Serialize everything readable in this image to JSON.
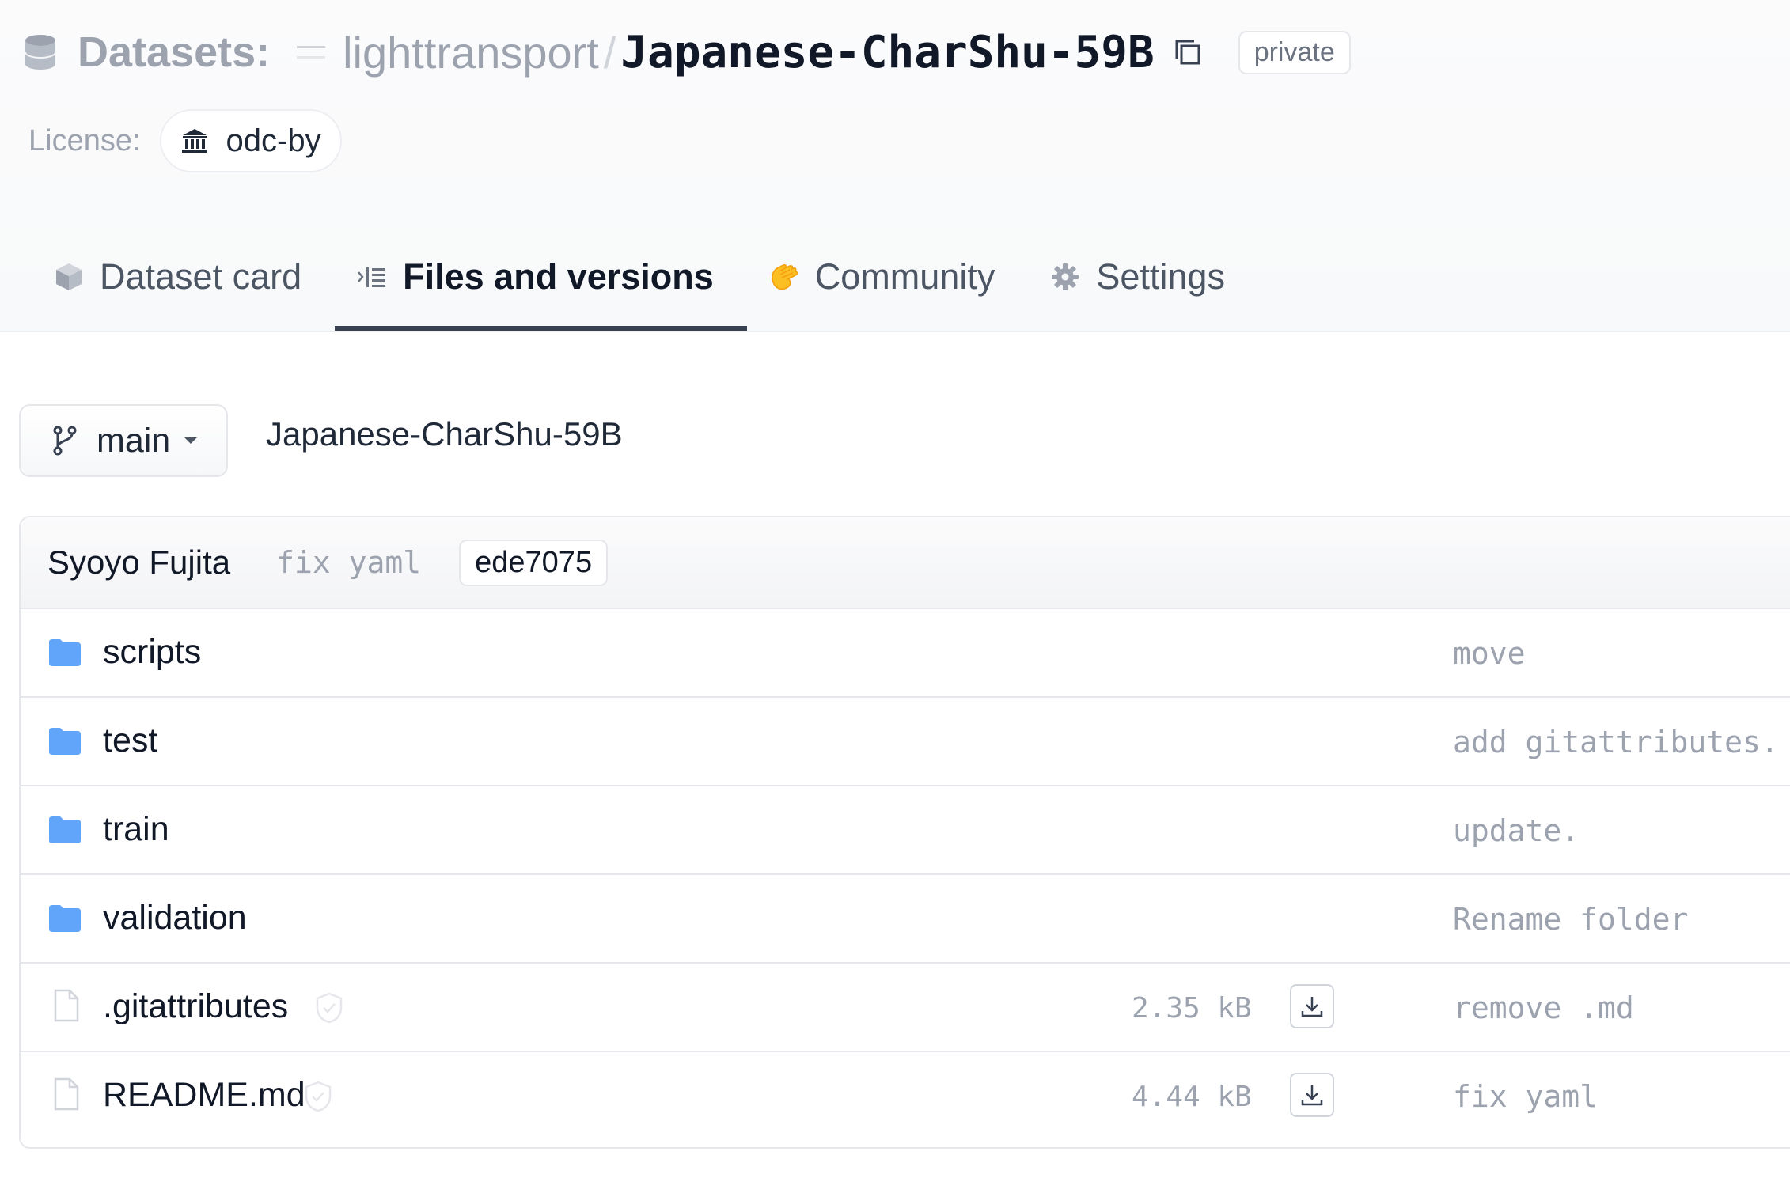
{
  "header": {
    "datasets_label": "Datasets:",
    "owner": "lighttransport",
    "separator": "/",
    "repo_name": "Japanese-CharShu-59B",
    "visibility": "private",
    "license_label": "License:",
    "license_value": "odc-by"
  },
  "tabs": [
    {
      "label": "Dataset card",
      "icon": "cube-icon",
      "active": false
    },
    {
      "label": "Files and versions",
      "icon": "files-icon",
      "active": true
    },
    {
      "label": "Community",
      "icon": "clapping-hands-icon",
      "active": false
    },
    {
      "label": "Settings",
      "icon": "gear-icon",
      "active": false
    }
  ],
  "toolbar": {
    "branch": "main",
    "path": "Japanese-CharShu-59B"
  },
  "last_commit": {
    "author": "Syoyo Fujita",
    "message": "fix yaml",
    "hash": "ede7075"
  },
  "files": [
    {
      "name": "scripts",
      "type": "folder",
      "commit": "move"
    },
    {
      "name": "test",
      "type": "folder",
      "commit": "add gitattributes."
    },
    {
      "name": "train",
      "type": "folder",
      "commit": "update."
    },
    {
      "name": "validation",
      "type": "folder",
      "commit": "Rename folder"
    },
    {
      "name": ".gitattributes",
      "type": "file",
      "size": "2.35 kB",
      "commit": "remove .md"
    },
    {
      "name": "README.md",
      "type": "file",
      "size": "4.44 kB",
      "commit": "fix yaml"
    }
  ],
  "colors": {
    "folder": "#60a5fa",
    "accent_tab_underline": "#374151",
    "muted_text": "#9ca3af",
    "community_icon": "#fbbf24"
  }
}
